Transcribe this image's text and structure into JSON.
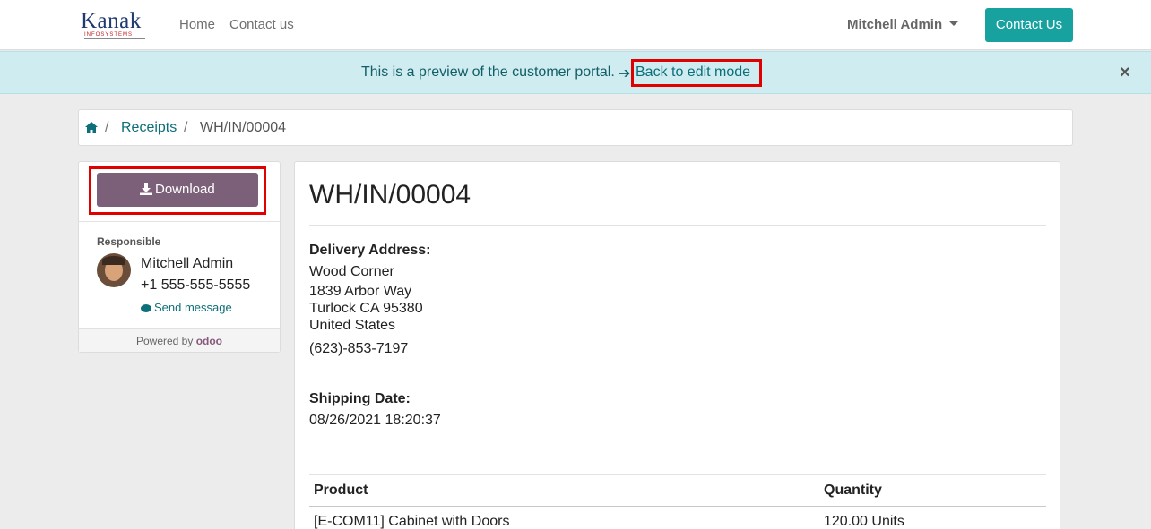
{
  "header": {
    "logo_text": "Kanak",
    "logo_subtext": "INFOSYSTEMS",
    "nav": [
      {
        "label": "Home"
      },
      {
        "label": "Contact us"
      }
    ],
    "user_name": "Mitchell Admin",
    "contact_button": "Contact Us"
  },
  "alert": {
    "message": "This is a preview of the customer portal.",
    "link": "Back to edit mode",
    "close": "×"
  },
  "breadcrumb": {
    "sep": "/",
    "items": [
      {
        "label": "Receipts"
      },
      {
        "label": "WH/IN/00004"
      }
    ]
  },
  "sidebar": {
    "download_label": "Download",
    "responsible_label": "Responsible",
    "responsible_name": "Mitchell Admin",
    "responsible_phone": "+1 555-555-5555",
    "send_message": "Send message",
    "powered_by": "Powered by",
    "odoo": "odoo"
  },
  "document": {
    "title": "WH/IN/00004",
    "delivery_label": "Delivery Address:",
    "address": [
      "Wood Corner",
      "1839 Arbor Way",
      "Turlock CA 95380",
      "United States"
    ],
    "phone": "(623)-853-7197",
    "shipping_label": "Shipping Date:",
    "shipping_date": "08/26/2021 18:20:37",
    "table": {
      "headers": [
        "Product",
        "Quantity"
      ],
      "rows": [
        {
          "product": "[E-COM11] Cabinet with Doors",
          "quantity": "120.00 Units"
        }
      ]
    }
  },
  "colors": {
    "accent": "#17a2a0",
    "download_button": "#7c5f78",
    "alert_bg": "#cfecf0",
    "highlight": "#e00000"
  }
}
